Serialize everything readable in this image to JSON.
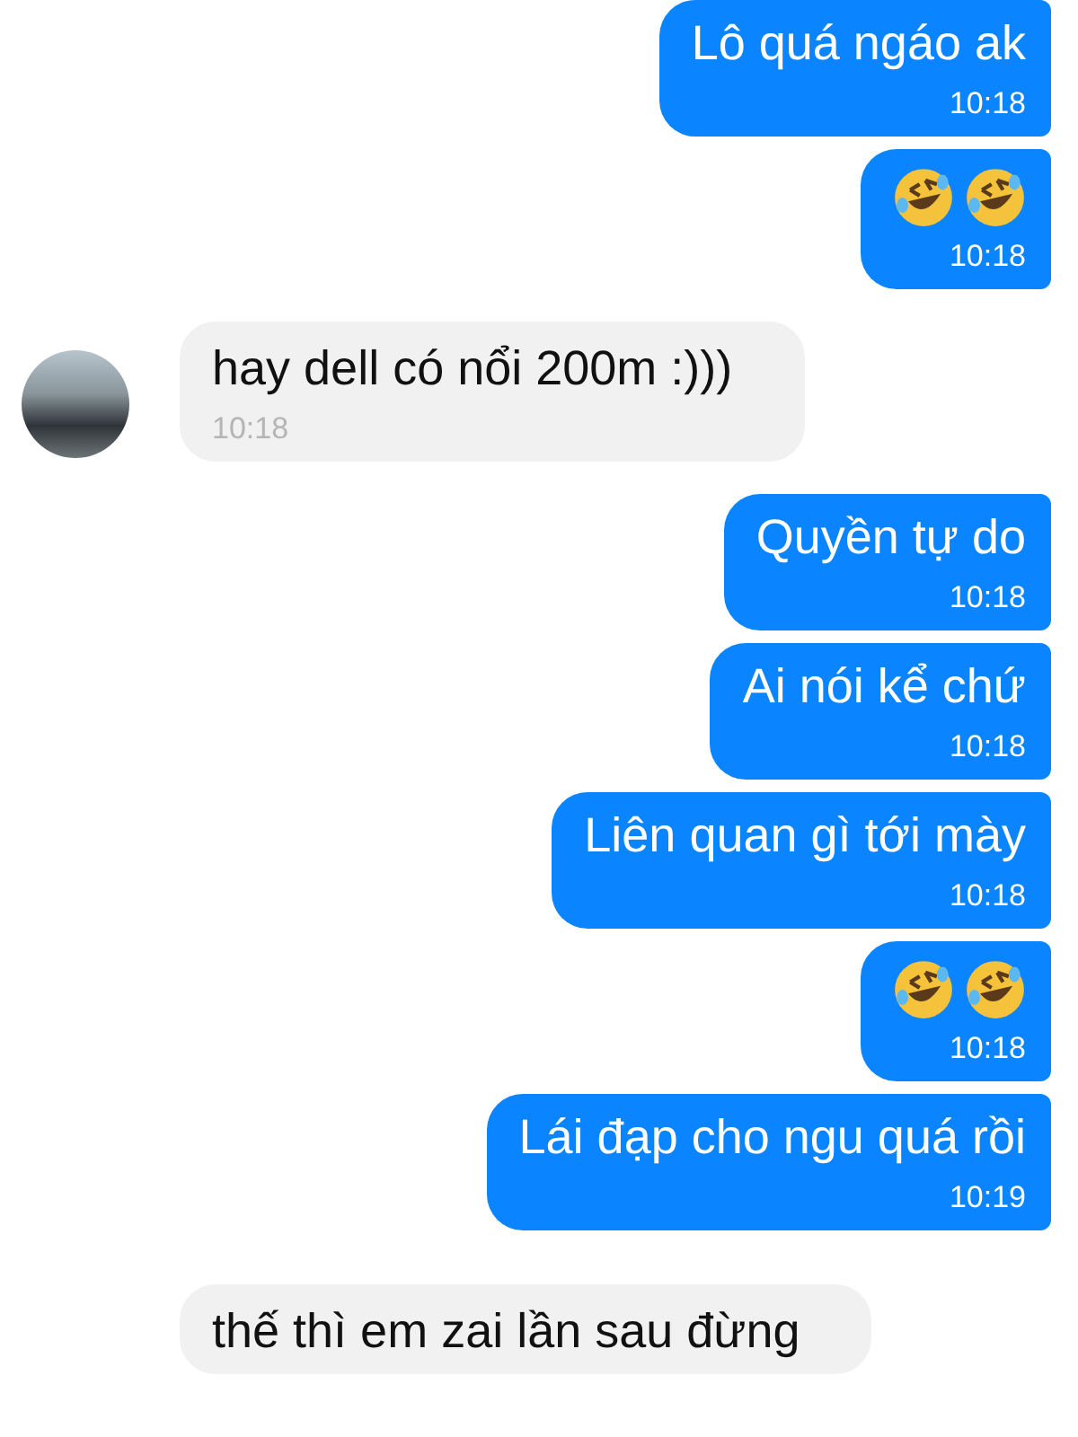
{
  "messages": [
    {
      "kind": "text",
      "outgoing": true,
      "text": "Lô quá ngáo ak",
      "time": "10:18"
    },
    {
      "kind": "emoji",
      "outgoing": true,
      "time": "10:18"
    },
    {
      "kind": "text",
      "outgoing": false,
      "text": "hay dell có nổi 200m :)))",
      "time": "10:18"
    },
    {
      "kind": "text",
      "outgoing": true,
      "text": "Quyền tự do",
      "time": "10:18"
    },
    {
      "kind": "text",
      "outgoing": true,
      "text": "Ai nói kể chứ",
      "time": "10:18"
    },
    {
      "kind": "text",
      "outgoing": true,
      "text": "Liên quan gì tới mày",
      "time": "10:18"
    },
    {
      "kind": "emoji",
      "outgoing": true,
      "time": "10:18"
    },
    {
      "kind": "text",
      "outgoing": true,
      "text": "Lái đạp cho ngu quá rồi",
      "time": "10:19"
    },
    {
      "kind": "text",
      "outgoing": false,
      "text": "thế thì em zai lần sau đừng"
    }
  ]
}
